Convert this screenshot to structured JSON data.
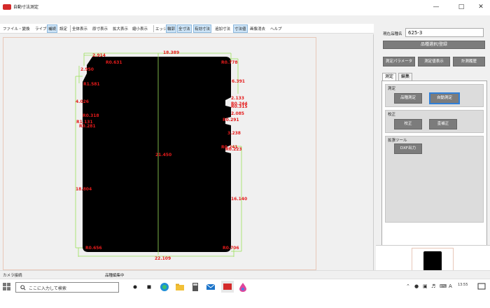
{
  "window": {
    "title": "自動寸法測定",
    "controls": [
      "—",
      "□",
      "✕"
    ]
  },
  "menu": [
    {
      "label": "ファイル・變換",
      "active": false
    },
    {
      "label": "ライブ",
      "active": false
    },
    {
      "label": "補続",
      "active": true
    },
    {
      "label": "設定",
      "active": false
    },
    {
      "label": "全体表示",
      "active": false
    },
    {
      "label": "原寸表示",
      "active": false
    },
    {
      "label": "拡大表示",
      "active": false
    },
    {
      "label": "縮小表示",
      "active": false
    },
    {
      "label": "エッジ",
      "active": false
    },
    {
      "label": "輪郭",
      "active": true
    },
    {
      "label": "全寸法",
      "active": true
    },
    {
      "label": "有効寸法",
      "active": true
    },
    {
      "label": "追加寸法",
      "active": false
    },
    {
      "label": "寸法値",
      "active": true
    },
    {
      "label": "画像消去",
      "active": false
    },
    {
      "label": "ヘルプ",
      "active": false
    }
  ],
  "dimensions": [
    {
      "label": "18.389"
    },
    {
      "label": "2.914"
    },
    {
      "label": "R0.631"
    },
    {
      "label": "R0.778"
    },
    {
      "label": "2.950"
    },
    {
      "label": "R1.581"
    },
    {
      "label": "6.391"
    },
    {
      "label": "2.133"
    },
    {
      "label": "4.026"
    },
    {
      "label": "R0.244"
    },
    {
      "label": "R0.315"
    },
    {
      "label": "2.085"
    },
    {
      "label": "R0.318"
    },
    {
      "label": "R1.131"
    },
    {
      "label": "R0.291"
    },
    {
      "label": "R0.281"
    },
    {
      "label": "3.238"
    },
    {
      "label": "R0.241"
    },
    {
      "label": "R0.223"
    },
    {
      "label": "21.450"
    },
    {
      "label": "18.804"
    },
    {
      "label": "16.140"
    },
    {
      "label": "R0.656"
    },
    {
      "label": "R0.706"
    },
    {
      "label": "22.109"
    }
  ],
  "status": {
    "camera": "カメラ接続",
    "mode": "品種編集中"
  },
  "panel": {
    "product_label": "現在品種名",
    "product_value": "625-3",
    "select_button": "品種選択/登録",
    "param_button": "測定パラメータ",
    "value_button": "測定値表示",
    "history_button": "計測履歴",
    "tabs": [
      "測定",
      "編集"
    ],
    "group_measure": "測定",
    "btn_product_measure": "品種測定",
    "btn_auto_measure": "自動測定",
    "group_calib": "校正",
    "btn_calib": "校正",
    "btn_recalib": "歪補正",
    "group_ext": "拡張ツール",
    "btn_dxf": "DXF出力"
  },
  "taskbar": {
    "search_placeholder": "ここに入力して検索",
    "tray_time": "13:55"
  },
  "colors": {
    "dimension_text": "#e41b1b",
    "dimension_line": "#9be05a",
    "shape_fill": "#000000",
    "button_gray": "#7c7c7c",
    "focus_blue": "#2f7fd8"
  }
}
